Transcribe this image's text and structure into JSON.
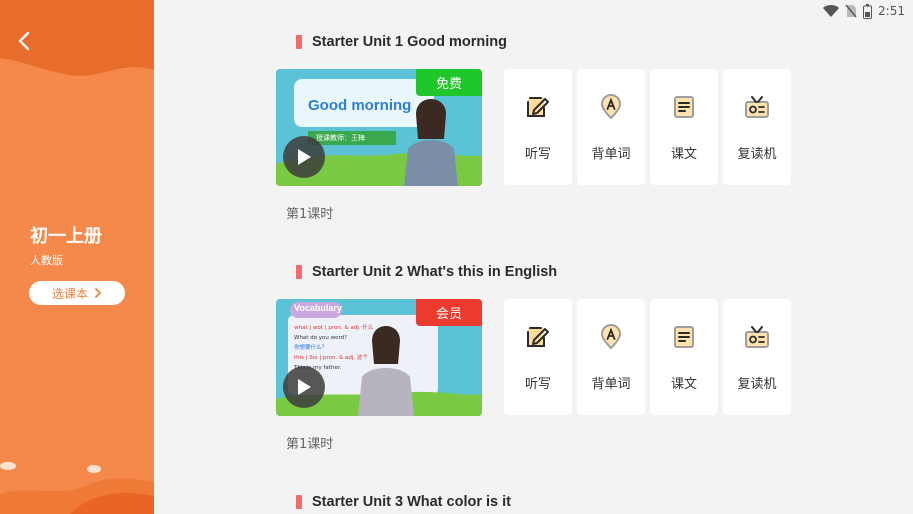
{
  "status": {
    "time": "2:51"
  },
  "sidebar": {
    "book_title": "初一上册",
    "edition": "人教版",
    "select_label": "选课本"
  },
  "units": [
    {
      "title": "Starter Unit 1 Good morning",
      "badge": "免费",
      "badge_color": "#1fc72a",
      "video_caption": "Good morning",
      "teacher": "授课教师：王梅",
      "lesson": "第1课时",
      "actions": [
        "听写",
        "背单词",
        "课文",
        "复读机"
      ]
    },
    {
      "title": "Starter Unit 2 What's this in English",
      "badge": "会员",
      "badge_color": "#ec3a2f",
      "video_caption": "Vocabulary",
      "board_lines": [
        "what | wɒt | pron. & adj. 什么",
        "What do you word?",
        "你想要什么？",
        "this | ðɪs | pron. & adj. 这个",
        "This is my father."
      ],
      "lesson": "第1课时",
      "actions": [
        "听写",
        "背单词",
        "课文",
        "复读机"
      ]
    },
    {
      "title": "Starter Unit 3 What color is it"
    }
  ],
  "icons": {
    "dictation": "pencil-note-icon",
    "vocabulary": "letter-a-pin-icon",
    "text": "document-icon",
    "repeater": "radio-icon"
  }
}
